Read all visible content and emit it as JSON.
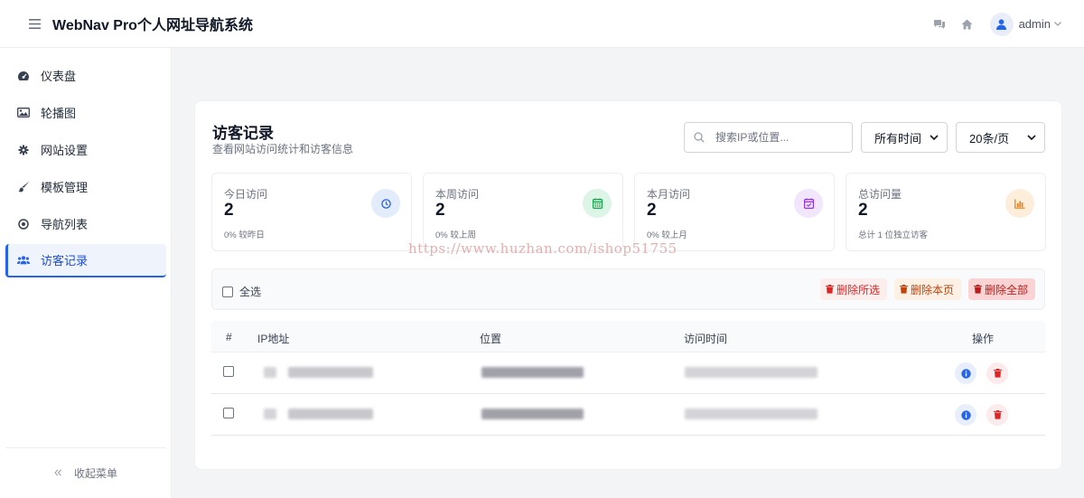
{
  "header": {
    "title": "WebNav Pro个人网址导航系统",
    "user": "admin"
  },
  "sidebar": {
    "items": [
      {
        "label": "仪表盘",
        "icon": "dashboard-icon"
      },
      {
        "label": "轮播图",
        "icon": "image-icon"
      },
      {
        "label": "网站设置",
        "icon": "gear-icon"
      },
      {
        "label": "模板管理",
        "icon": "brush-icon"
      },
      {
        "label": "导航列表",
        "icon": "compass-icon"
      },
      {
        "label": "访客记录",
        "icon": "users-icon",
        "active": true
      }
    ],
    "collapse_label": "收起菜单"
  },
  "page": {
    "title": "访客记录",
    "subtitle": "查看网站访问统计和访客信息",
    "search_placeholder": "搜索IP或位置...",
    "time_filter": "所有时间",
    "page_size": "20条/页"
  },
  "stats": [
    {
      "label": "今日访问",
      "value": "2",
      "note": "0% 较昨日",
      "icon": "clock-icon",
      "bg": "#e3ecfb",
      "fg": "#2563eb"
    },
    {
      "label": "本周访问",
      "value": "2",
      "note": "0% 较上周",
      "icon": "calendar-icon",
      "bg": "#dcf5e7",
      "fg": "#16a34a"
    },
    {
      "label": "本月访问",
      "value": "2",
      "note": "0% 较上月",
      "icon": "calendar-check-icon",
      "bg": "#f1e6fb",
      "fg": "#9333ea"
    },
    {
      "label": "总访问量",
      "value": "2",
      "note": "总计 1 位独立访客",
      "icon": "bar-chart-icon",
      "bg": "#fdeedb",
      "fg": "#ea7b0c"
    }
  ],
  "toolbar": {
    "select_all": "全选",
    "delete_selected": "删除所选",
    "delete_page": "删除本页",
    "delete_all": "删除全部"
  },
  "table": {
    "columns": [
      "#",
      "IP地址",
      "位置",
      "访问时间",
      "操作"
    ]
  },
  "watermark": "https://www.huzhan.com/ishop51755"
}
